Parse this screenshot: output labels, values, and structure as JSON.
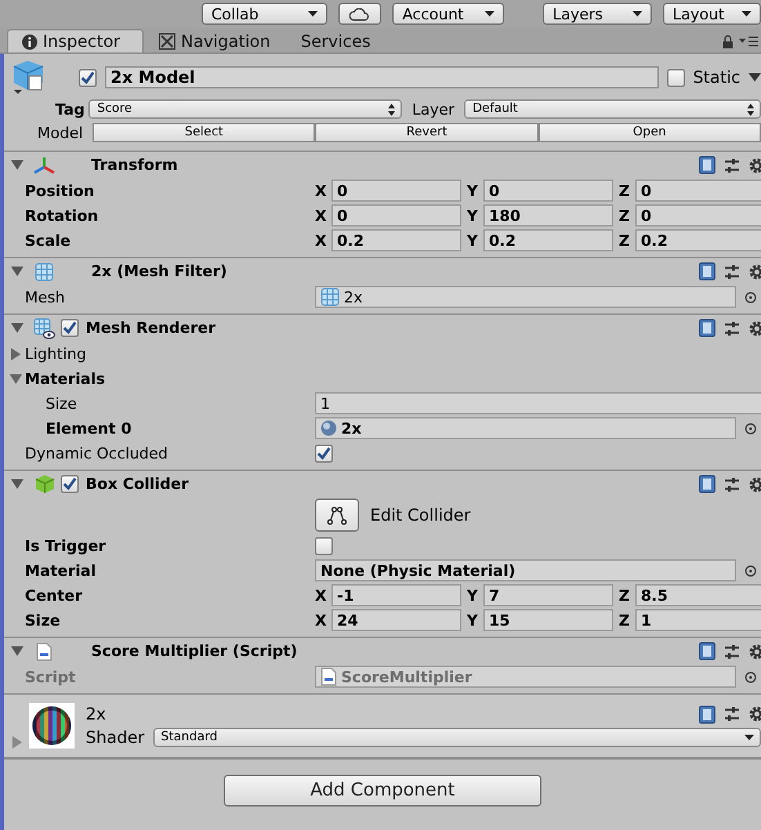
{
  "toolbar": {
    "collab": "Collab",
    "account": "Account",
    "layers": "Layers",
    "layout": "Layout"
  },
  "tabs": [
    {
      "label": "Inspector",
      "selected": true,
      "kind": "info"
    },
    {
      "label": "Navigation",
      "selected": false,
      "kind": "navigation"
    },
    {
      "label": "Services",
      "selected": false,
      "kind": "plain"
    }
  ],
  "object": {
    "name": "2x Model",
    "active": true,
    "static_label": "Static",
    "static": false,
    "tag_label": "Tag",
    "tag": "Score",
    "layer_label": "Layer",
    "layer": "Default",
    "model_label": "Model",
    "model_buttons": [
      "Select",
      "Revert",
      "Open"
    ]
  },
  "components": [
    {
      "title": "Transform",
      "kind": "transform",
      "expanded": true,
      "rows": [
        {
          "kind": "vector",
          "label": "Position",
          "bold": true,
          "values": [
            {
              "axis": "X",
              "value": "0"
            },
            {
              "axis": "Y",
              "value": "0"
            },
            {
              "axis": "Z",
              "value": "0"
            }
          ]
        },
        {
          "kind": "vector",
          "label": "Rotation",
          "bold": true,
          "values": [
            {
              "axis": "X",
              "value": "0"
            },
            {
              "axis": "Y",
              "value": "180"
            },
            {
              "axis": "Z",
              "value": "0"
            }
          ]
        },
        {
          "kind": "vector",
          "label": "Scale",
          "bold": true,
          "values": [
            {
              "axis": "X",
              "value": "0.2"
            },
            {
              "axis": "Y",
              "value": "0.2"
            },
            {
              "axis": "Z",
              "value": "0.2"
            }
          ]
        }
      ]
    },
    {
      "title": "2x (Mesh Filter)",
      "kind": "mesh",
      "expanded": true,
      "rows": [
        {
          "kind": "mesh_ref",
          "label": "Mesh",
          "bold": false,
          "value": "2x"
        }
      ]
    },
    {
      "title": "Mesh Renderer",
      "kind": "renderer",
      "enabled": true,
      "expanded": true,
      "rows": [
        {
          "kind": "foldout",
          "label": "Lighting",
          "bold": false,
          "expanded": false
        },
        {
          "kind": "foldout",
          "label": "Materials",
          "bold": true,
          "expanded": true,
          "children": [
            {
              "kind": "text",
              "label": "Size",
              "bold": false,
              "value": "1"
            },
            {
              "kind": "material_ref",
              "label": "Element 0",
              "bold": true,
              "value": "2x"
            }
          ]
        },
        {
          "kind": "checkbox",
          "label": "Dynamic Occluded",
          "bold": false,
          "checked": true
        }
      ]
    },
    {
      "title": "Box Collider",
      "kind": "collider",
      "enabled": true,
      "expanded": true,
      "rows": [
        {
          "kind": "button",
          "label": "Edit Collider"
        },
        {
          "kind": "checkbox",
          "label": "Is Trigger",
          "bold": true,
          "checked": false
        },
        {
          "kind": "object",
          "label": "Material",
          "bold": true,
          "value": "None (Physic Material)"
        },
        {
          "kind": "vector",
          "label": "Center",
          "bold": true,
          "values": [
            {
              "axis": "X",
              "value": "-1"
            },
            {
              "axis": "Y",
              "value": "7"
            },
            {
              "axis": "Z",
              "value": "8.5"
            }
          ]
        },
        {
          "kind": "vector",
          "label": "Size",
          "bold": true,
          "values": [
            {
              "axis": "X",
              "value": "24"
            },
            {
              "axis": "Y",
              "value": "15"
            },
            {
              "axis": "Z",
              "value": "1"
            }
          ]
        }
      ]
    },
    {
      "title": "Score Multiplier (Script)",
      "kind": "script",
      "expanded": true,
      "rows": [
        {
          "kind": "script_ref",
          "label": "Script",
          "bold": true,
          "disabled": true,
          "value": "ScoreMultiplier"
        }
      ]
    }
  ],
  "material": {
    "name": "2x",
    "shader_label": "Shader",
    "shader": "Standard",
    "expanded": false
  },
  "add_button": "Add Component"
}
